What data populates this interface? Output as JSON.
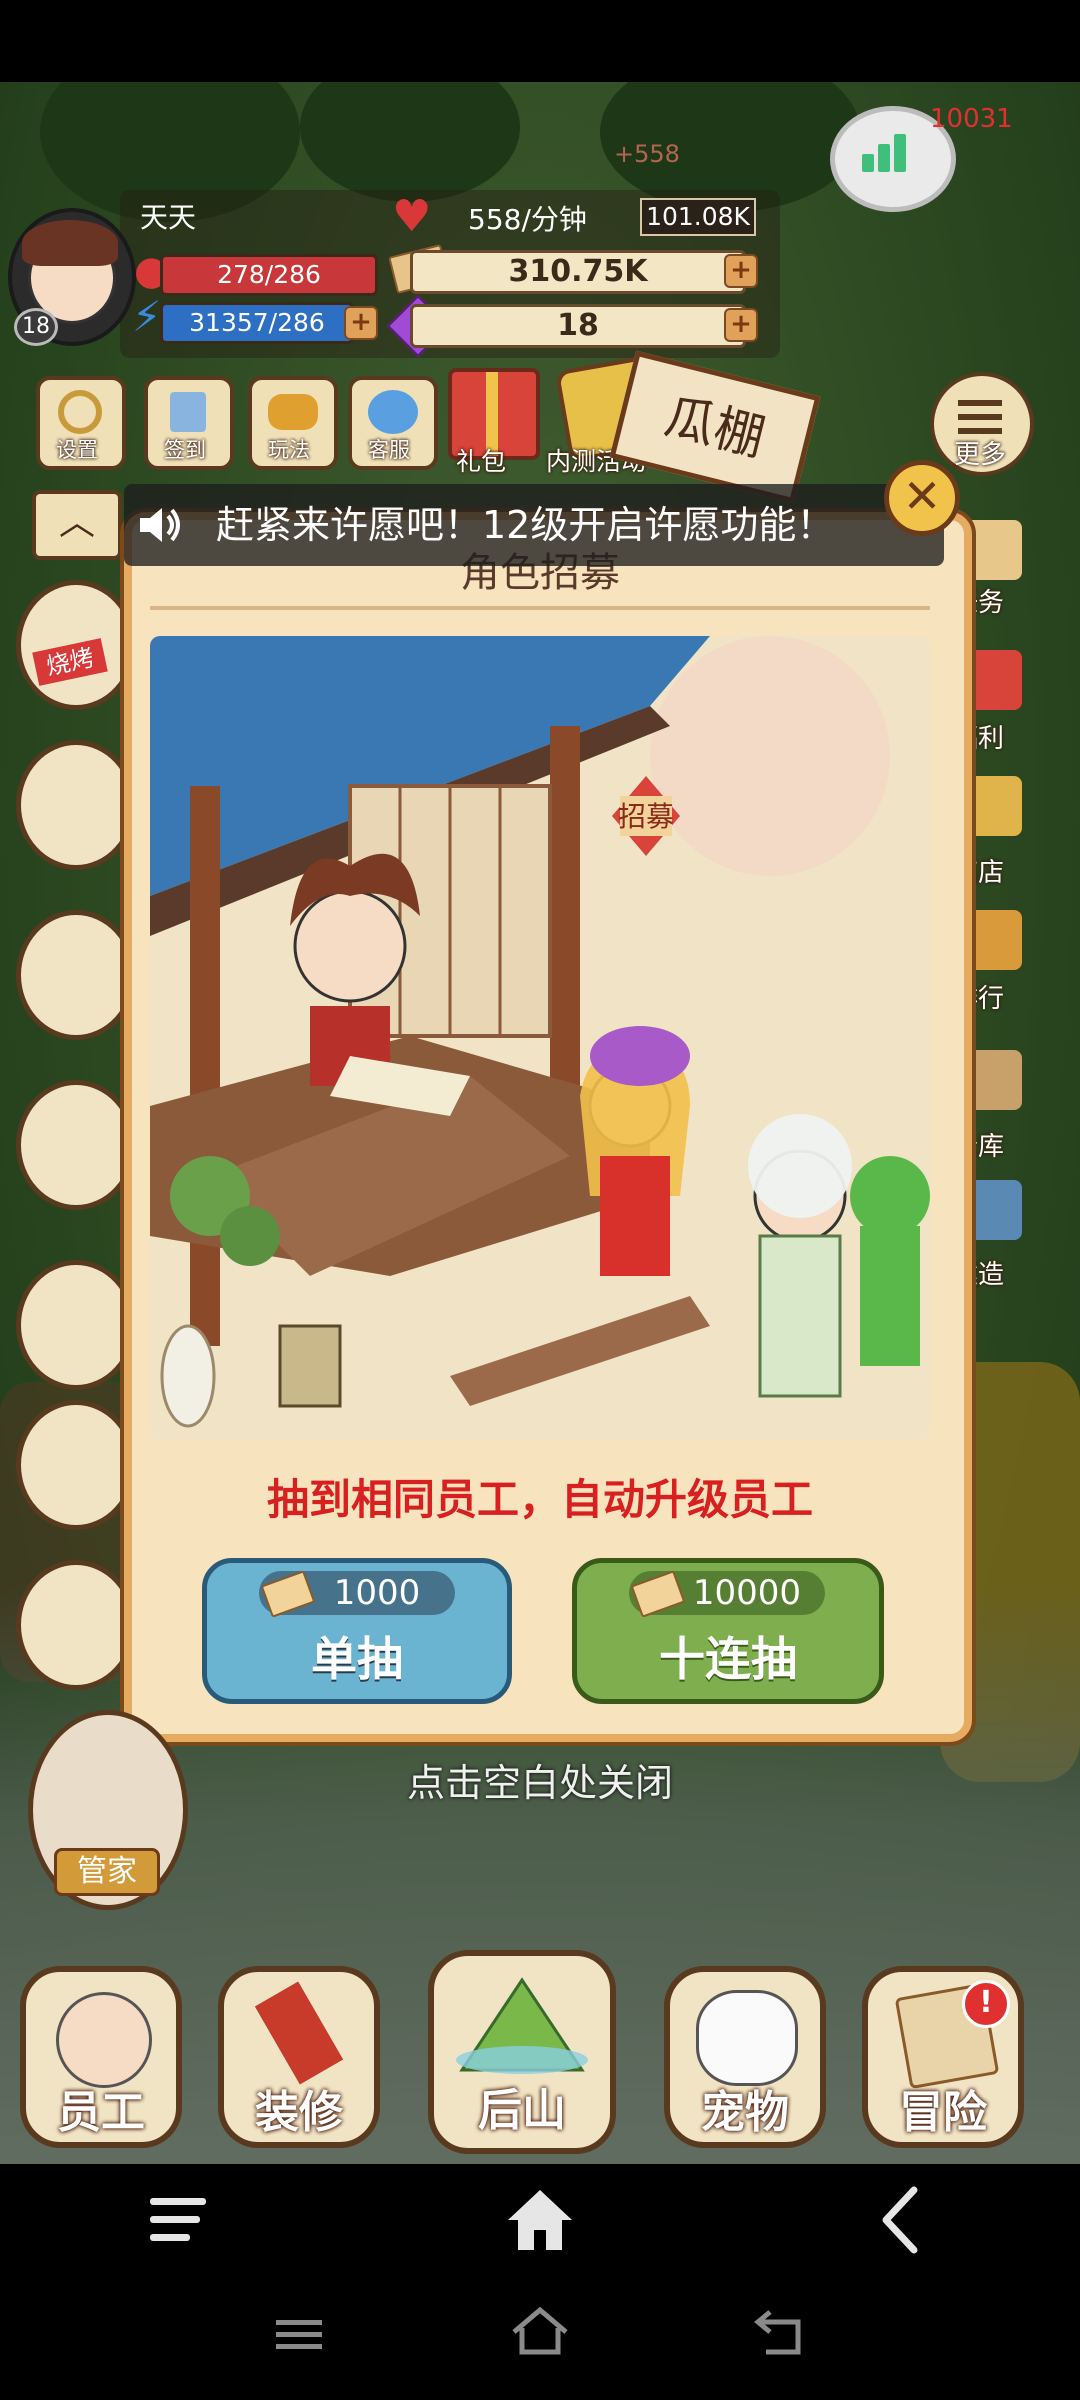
{
  "hud": {
    "player_name": "天天",
    "level": "18",
    "health": "278/286",
    "energy": "31357/286",
    "rate": "558/分钟",
    "rate_total": "101.08K",
    "money": "310.75K",
    "gems": "18",
    "floating_gain": "+558",
    "corner_number": "10031"
  },
  "top_icons": {
    "settings": "设置",
    "checkin": "签到",
    "gameplay": "玩法",
    "service": "客服",
    "gift": "礼包",
    "beta_event": "内测活动",
    "shed_sign": "瓜棚",
    "more": "更多"
  },
  "right_menu": [
    "任务",
    "福利",
    "商店",
    "排行",
    "仓库",
    "建造"
  ],
  "side_icons": {
    "bbq_label": "烧烤"
  },
  "notice": {
    "text": "赶紧来许愿吧！12级开启许愿功能！"
  },
  "dialog": {
    "title": "角色招募",
    "scene_sign": "招募",
    "hint": "抽到相同员工，自动升级员工",
    "single": {
      "cost": "1000",
      "label": "单抽"
    },
    "ten": {
      "cost": "10000",
      "label": "十连抽"
    },
    "close_hint": "点击空白处关闭"
  },
  "butler": {
    "label": "管家"
  },
  "bottom_nav": [
    "员工",
    "装修",
    "后山",
    "宠物",
    "冒险"
  ],
  "colors": {
    "dialog_bg": "#f7e4be",
    "dialog_border": "#e6aa60",
    "hint_red": "#d82020",
    "single_blue": "#6ab4d2",
    "ten_green": "#7fae4e"
  }
}
